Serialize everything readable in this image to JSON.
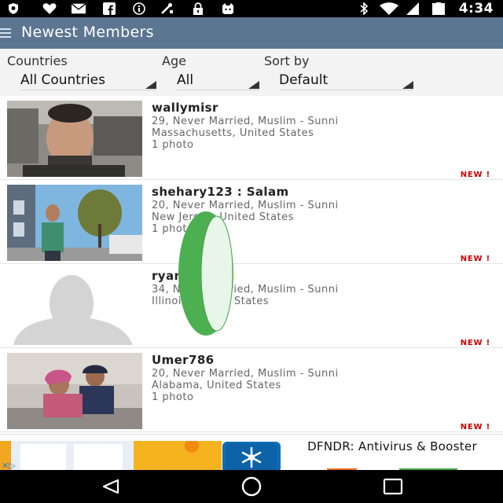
{
  "status_bar": {
    "time": "4:34",
    "left_icons": [
      "shield-icon",
      "heart-icon",
      "mail-icon",
      "facebook-icon",
      "info-icon",
      "tools-icon",
      "lock-icon",
      "cat-icon"
    ],
    "right_icons": [
      "bluetooth-icon",
      "wifi-icon",
      "signal-icon",
      "battery-icon"
    ],
    "battery_glyph": "5"
  },
  "app_bar": {
    "title": "Newest Members"
  },
  "filters": {
    "countries": {
      "label": "Countries",
      "value": "All Countries"
    },
    "age": {
      "label": "Age",
      "value": "All"
    },
    "sort": {
      "label": "Sort by",
      "value": "Default"
    }
  },
  "members": [
    {
      "name": "wallymisr",
      "details": "29, Never Married, Muslim - Sunni",
      "location": "Massachusetts, United States",
      "photos": "1 photo",
      "badge": "NEW !"
    },
    {
      "name": "shehary123 : Salam",
      "details": "20, Never Married, Muslim - Sunni",
      "location": "New Jersey, United States",
      "photos": "1 photo",
      "badge": "NEW !"
    },
    {
      "name": "ryan",
      "details": "34, Never Married, Muslim - Sunni",
      "location": "Illinois, United States",
      "photos": "",
      "badge": "NEW !"
    },
    {
      "name": "Umer786",
      "details": "20, Never Married, Muslim - Sunni",
      "location": "Alabama, United States",
      "photos": "1 photo",
      "badge": "NEW !"
    }
  ],
  "ad": {
    "title": "DFNDR: Antivirus & Booster"
  },
  "colors": {
    "app_bar": "#5c7591",
    "new_badge": "#cc0000",
    "overlay_green": "#4caf50"
  }
}
